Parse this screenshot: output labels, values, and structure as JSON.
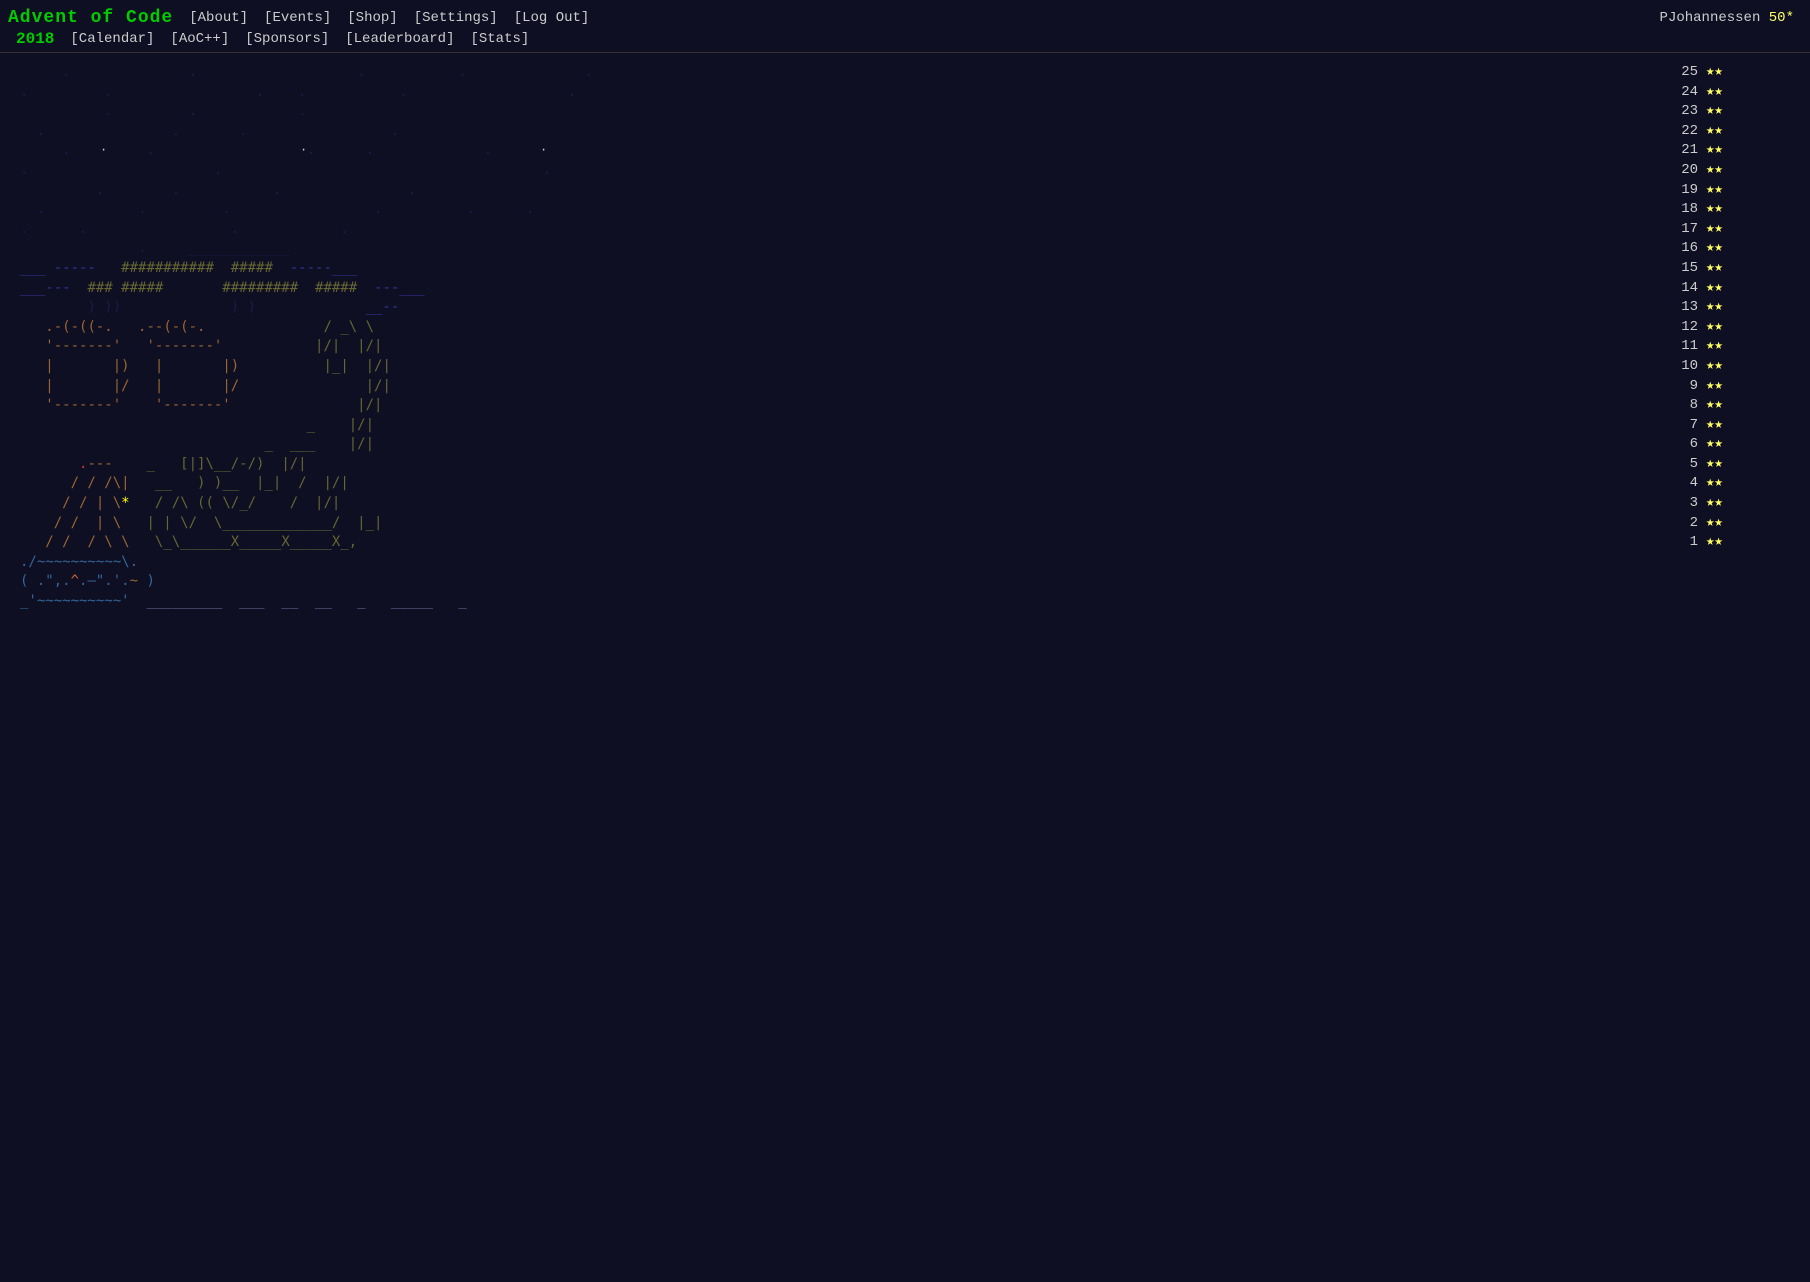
{
  "header": {
    "title": "Advent of Code",
    "year": "2018",
    "nav_row1": [
      "[About]",
      "[Events]",
      "[Shop]",
      "[Settings]",
      "[Log Out]"
    ],
    "nav_row2": [
      "[Calendar]",
      "[AoC++]",
      "[Sponsors]",
      "[Leaderboard]",
      "[Stats]"
    ],
    "user": "PJohannessen",
    "user_stars": "50*"
  },
  "days": [
    {
      "num": "25",
      "stars": "★★"
    },
    {
      "num": "24",
      "stars": "★★"
    },
    {
      "num": "23",
      "stars": "★★"
    },
    {
      "num": "22",
      "stars": "★★"
    },
    {
      "num": "21",
      "stars": "★★"
    },
    {
      "num": "20",
      "stars": "★★"
    },
    {
      "num": "19",
      "stars": "★★"
    },
    {
      "num": "18",
      "stars": "★★"
    },
    {
      "num": "17",
      "stars": "★★"
    },
    {
      "num": "16",
      "stars": "★★"
    },
    {
      "num": "15",
      "stars": "★★"
    },
    {
      "num": "14",
      "stars": "★★"
    },
    {
      "num": "13",
      "stars": "★★"
    },
    {
      "num": "12",
      "stars": "★★"
    },
    {
      "num": "11",
      "stars": "★★"
    },
    {
      "num": "10",
      "stars": "★★"
    },
    {
      "num": "9",
      "stars": "★★"
    },
    {
      "num": "8",
      "stars": "★★"
    },
    {
      "num": "7",
      "stars": "★★"
    },
    {
      "num": "6",
      "stars": "★★"
    },
    {
      "num": "5",
      "stars": "★★"
    },
    {
      "num": "4",
      "stars": "★★"
    },
    {
      "num": "3",
      "stars": "★★"
    },
    {
      "num": "2",
      "stars": "★★"
    },
    {
      "num": "1",
      "stars": "★★"
    }
  ],
  "ascii_art": "     .              .                   .           .              .        \n.         .                 .    .           .                   .        \n          .         .            .                                        \n  .               .       .                 .                            \n     .         .                  .      .             .                  \n.                      .                                      .          \n         .        .           .               .                          \n  .           .         .                 .          .      .            \n.      .                 .            .                                   \n              .     ____________                                          \n___ -----   ###########  #####  -----___                                  \n___---  ### #####       ######### #####  ---___                           \n        ) ))             ) )             __--                             \n   .-(-((-. .--(-(-. / _\\ \\                                               \n   '-------' '-------'     |/|  |/|                                      \n   |       |) |       |)  |_|  |/|                                       \n   |       |/ |       |/       |/|                                       \n   '-------'  '-------'        |/|                                       \n                          _    |/|                                        \n                     _  ___    |/|                                        \n       .---    _  [|]\\__/-/)  |/|                                        \n      / / /\\| __   ) )__  |_|  /  |/|                                   \n     / / | \\* / /\\ (( \\/_/    /  |/|                                    \n    / /  | \\ | | \\/  \\_____________/  |_|                               \n   / /  / \\ \\ \\_\\______X_____X_____X_,                                   \n./~~~~~~~~~~\\.                                                             \n( .\",.^.-\".'.~ )                                                          \n_'~~~~~~~~~~'  _________ ___ __ __  _   _____  _"
}
